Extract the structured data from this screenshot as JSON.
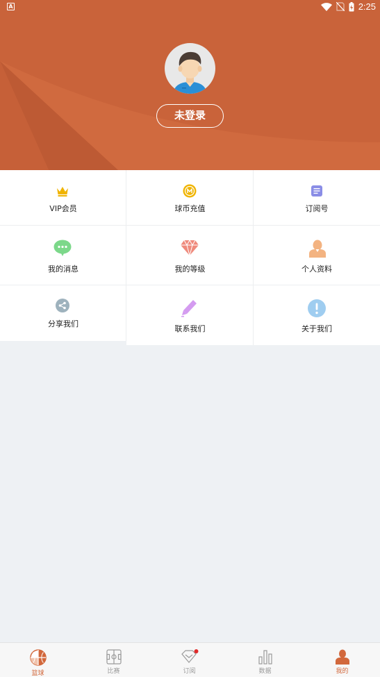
{
  "status_bar": {
    "time": "2:25",
    "app_icon_letter": "A"
  },
  "header": {
    "login_label": "未登录",
    "bg_color": "#c9633a"
  },
  "grid": {
    "items": [
      {
        "label": "VIP会员",
        "icon": "crown-icon",
        "color": "#f0b400"
      },
      {
        "label": "球币充值",
        "icon": "coin-icon",
        "color": "#f0b400"
      },
      {
        "label": "订阅号",
        "icon": "subscription-icon",
        "color": "#7c7fe0"
      },
      {
        "label": "我的消息",
        "icon": "message-icon",
        "color": "#7cd88a"
      },
      {
        "label": "我的等级",
        "icon": "diamond-icon",
        "color": "#ef8a7c"
      },
      {
        "label": "个人资料",
        "icon": "profile-icon",
        "color": "#f3b381"
      },
      {
        "label": "分享我们",
        "icon": "share-icon",
        "color": "#9eb2bd"
      },
      {
        "label": "联系我们",
        "icon": "pencil-icon",
        "color": "#d49bf0"
      },
      {
        "label": "关于我们",
        "icon": "info-icon",
        "color": "#9fcdf0"
      }
    ]
  },
  "bottom_nav": {
    "tabs": [
      {
        "label": "篮球",
        "icon": "basketball-icon",
        "active": true
      },
      {
        "label": "比赛",
        "icon": "court-icon",
        "active": false
      },
      {
        "label": "订阅",
        "icon": "subscribe-icon",
        "active": false,
        "badge": true
      },
      {
        "label": "数据",
        "icon": "bar-chart-icon",
        "active": false
      },
      {
        "label": "我的",
        "icon": "user-icon",
        "active": true
      }
    ],
    "active_color": "#d2683c",
    "inactive_color": "#9a9a9a"
  }
}
